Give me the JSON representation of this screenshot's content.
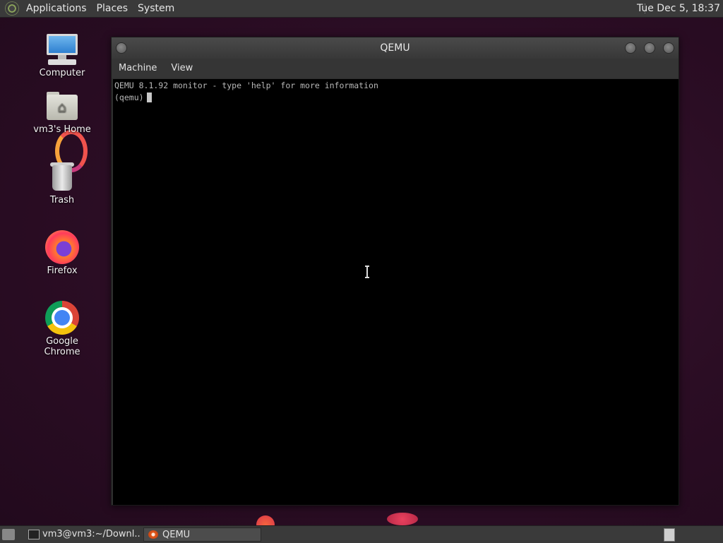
{
  "top_panel": {
    "menus": [
      "Applications",
      "Places",
      "System"
    ],
    "clock": "Tue Dec  5, 18:37"
  },
  "desktop": {
    "icons": [
      {
        "label": "Computer",
        "icon": "computer-icon"
      },
      {
        "label": "vm3's Home",
        "icon": "home-folder-icon"
      },
      {
        "label": "Trash",
        "icon": "trash-icon"
      },
      {
        "label": "Firefox",
        "icon": "firefox-icon"
      },
      {
        "label": "Google Chrome",
        "icon": "chrome-icon"
      }
    ]
  },
  "window": {
    "title": "QEMU",
    "menu": [
      "Machine",
      "View"
    ],
    "terminal_lines": [
      "QEMU 8.1.92 monitor - type 'help' for more information",
      "(qemu)"
    ]
  },
  "taskbar": {
    "tasks": [
      {
        "label": "vm3@vm3:~/Downl...",
        "icon": "terminal-icon"
      },
      {
        "label": "QEMU",
        "icon": "qemu-icon",
        "active": true
      }
    ]
  },
  "colors": {
    "panel": "#3a3a3a",
    "terminal_bg": "#000000",
    "terminal_fg": "#b8b8b8",
    "wallpaper": "#2c0f24"
  }
}
